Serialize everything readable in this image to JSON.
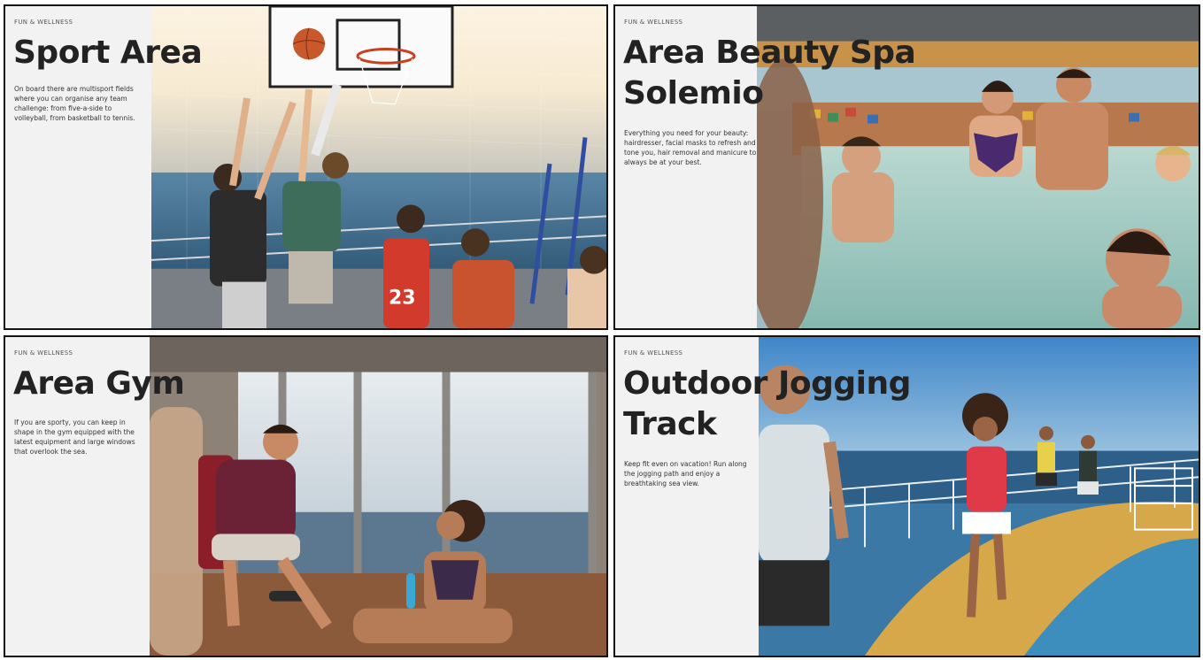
{
  "cards": [
    {
      "kicker": "FUN & WELLNESS",
      "title_lines": [
        "Sport Area"
      ],
      "description": "On board there are multisport fields where you can organise any team challenge: from five-a-side to volleyball, from basketball to tennis."
    },
    {
      "kicker": "FUN & WELLNESS",
      "title_lines": [
        "Area Beauty Spa",
        "Solemio"
      ],
      "description": "Everything you need for your beauty: hairdresser, facial masks to refresh and tone you, hair removal and manicure to always be at your best."
    },
    {
      "kicker": "FUN & WELLNESS",
      "title_lines": [
        "Area Gym"
      ],
      "description": "If you are sporty, you can keep in shape in the gym equipped with the latest equipment and large windows that overlook the sea."
    },
    {
      "kicker": "FUN & WELLNESS",
      "title_lines": [
        "Outdoor Jogging",
        "Track"
      ],
      "description": "Keep fit even on vacation! Run along the jogging path and enjoy a breathtaking sea view."
    }
  ],
  "jersey_number": "23",
  "colors": {
    "panel": "#f2f2f2",
    "title": "#222222",
    "sea": "#3f6f95",
    "sky": "#f4e9d4"
  }
}
